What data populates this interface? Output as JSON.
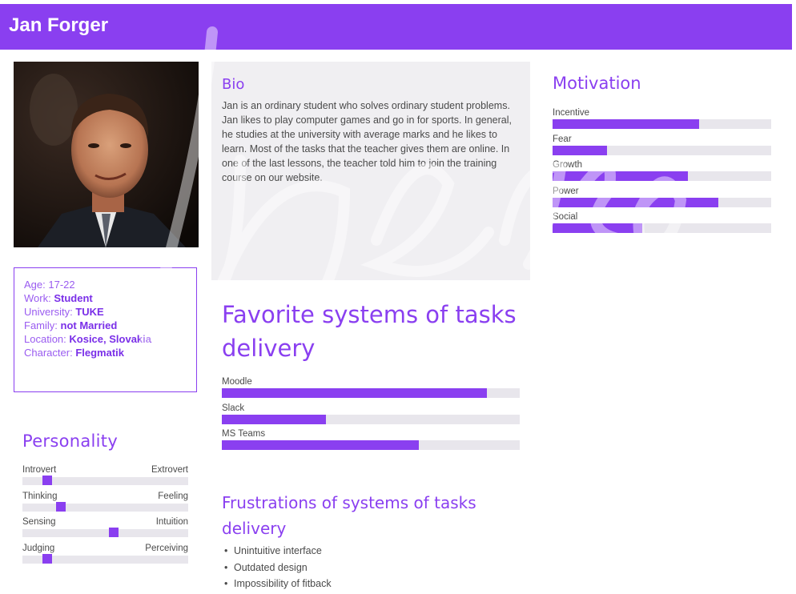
{
  "header": {
    "title": "Jan Forger"
  },
  "profile": {
    "rows": [
      {
        "key": "Age:",
        "value": "17-22",
        "bold": false
      },
      {
        "key": "Work:",
        "value": "Student",
        "bold": true
      },
      {
        "key": "University:",
        "value": "TUKE",
        "bold": true
      },
      {
        "key": "Family:",
        "value": "not Married",
        "bold": true
      },
      {
        "key": "Location:",
        "value": "Kosice, Slovakia",
        "bold": true
      },
      {
        "key": "Character:",
        "value": "Flegmatik",
        "bold": true
      }
    ]
  },
  "bio": {
    "title": "Bio",
    "text": "Jan is an ordinary student who solves ordinary student problems. Jan likes to play computer games and go in for sports. In general, he studies at the university with average marks and he likes to learn. Most of the tasks that the teacher gives them are online. In one of the last lessons, the teacher told him to join the training course on our website."
  },
  "motivation": {
    "title": "Motivation",
    "items": [
      {
        "label": "Incentive",
        "value": 0.67
      },
      {
        "label": "Fear",
        "value": 0.25
      },
      {
        "label": "Growth",
        "value": 0.62
      },
      {
        "label": "Power",
        "value": 0.76
      },
      {
        "label": "Social",
        "value": 0.41
      }
    ]
  },
  "favorite_systems": {
    "title": "Favorite systems of tasks delivery",
    "items": [
      {
        "label": "Moodle",
        "value": 0.89
      },
      {
        "label": "Slack",
        "value": 0.35
      },
      {
        "label": "MS Teams",
        "value": 0.66
      }
    ]
  },
  "frustrations": {
    "title": "Frustrations of systems of tasks delivery",
    "items": [
      "Unintuitive interface",
      "Outdated design",
      "Impossibility of fitback"
    ]
  },
  "personality": {
    "title": "Personality",
    "traits": [
      {
        "left": "Introvert",
        "right": "Extrovert",
        "value": 0.15
      },
      {
        "left": "Thinking",
        "right": "Feeling",
        "value": 0.23
      },
      {
        "left": "Sensing",
        "right": "Intuition",
        "value": 0.55
      },
      {
        "left": "Judging",
        "right": "Perceiving",
        "value": 0.15
      }
    ]
  },
  "colors": {
    "accent": "#8a3ff0",
    "track": "#e8e6ec",
    "panel": "#f0eff2"
  }
}
